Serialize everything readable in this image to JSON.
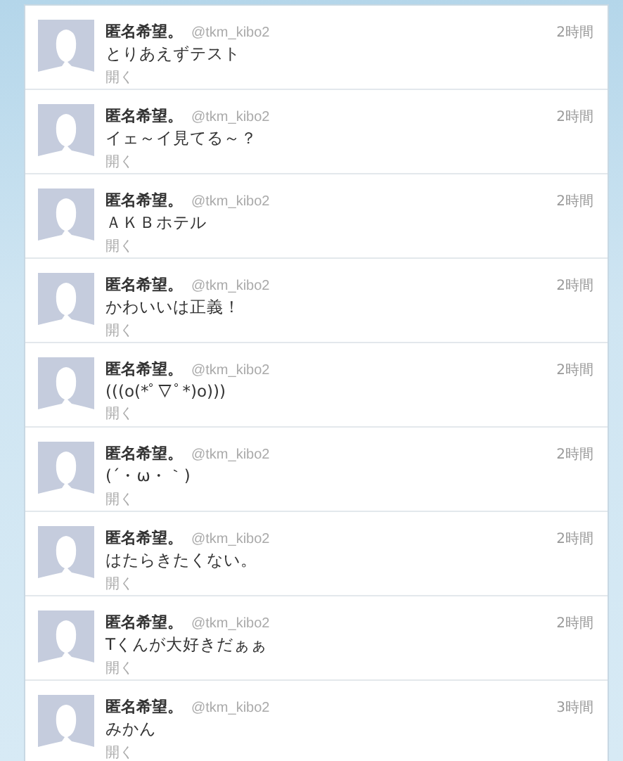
{
  "tweets": [
    {
      "name": "匿名希望。",
      "handle": "@tkm_kibo2",
      "time": "2時間",
      "text": "とりあえずテスト",
      "action": "開く"
    },
    {
      "name": "匿名希望。",
      "handle": "@tkm_kibo2",
      "time": "2時間",
      "text": "イェ～イ見てる～？",
      "action": "開く"
    },
    {
      "name": "匿名希望。",
      "handle": "@tkm_kibo2",
      "time": "2時間",
      "text": "ＡＫＢホテル",
      "action": "開く"
    },
    {
      "name": "匿名希望。",
      "handle": "@tkm_kibo2",
      "time": "2時間",
      "text": "かわいいは正義！",
      "action": "開く"
    },
    {
      "name": "匿名希望。",
      "handle": "@tkm_kibo2",
      "time": "2時間",
      "text": "(((o(*ﾟ▽ﾟ*)o)))",
      "action": "開く"
    },
    {
      "name": "匿名希望。",
      "handle": "@tkm_kibo2",
      "time": "2時間",
      "text": "(´・ω・｀)",
      "action": "開く"
    },
    {
      "name": "匿名希望。",
      "handle": "@tkm_kibo2",
      "time": "2時間",
      "text": "はたらきたくない。",
      "action": "開く"
    },
    {
      "name": "匿名希望。",
      "handle": "@tkm_kibo2",
      "time": "2時間",
      "text": "Tくんが大好きだぁぁ",
      "action": "開く"
    },
    {
      "name": "匿名希望。",
      "handle": "@tkm_kibo2",
      "time": "3時間",
      "text": "みかん",
      "action": "開く"
    }
  ]
}
